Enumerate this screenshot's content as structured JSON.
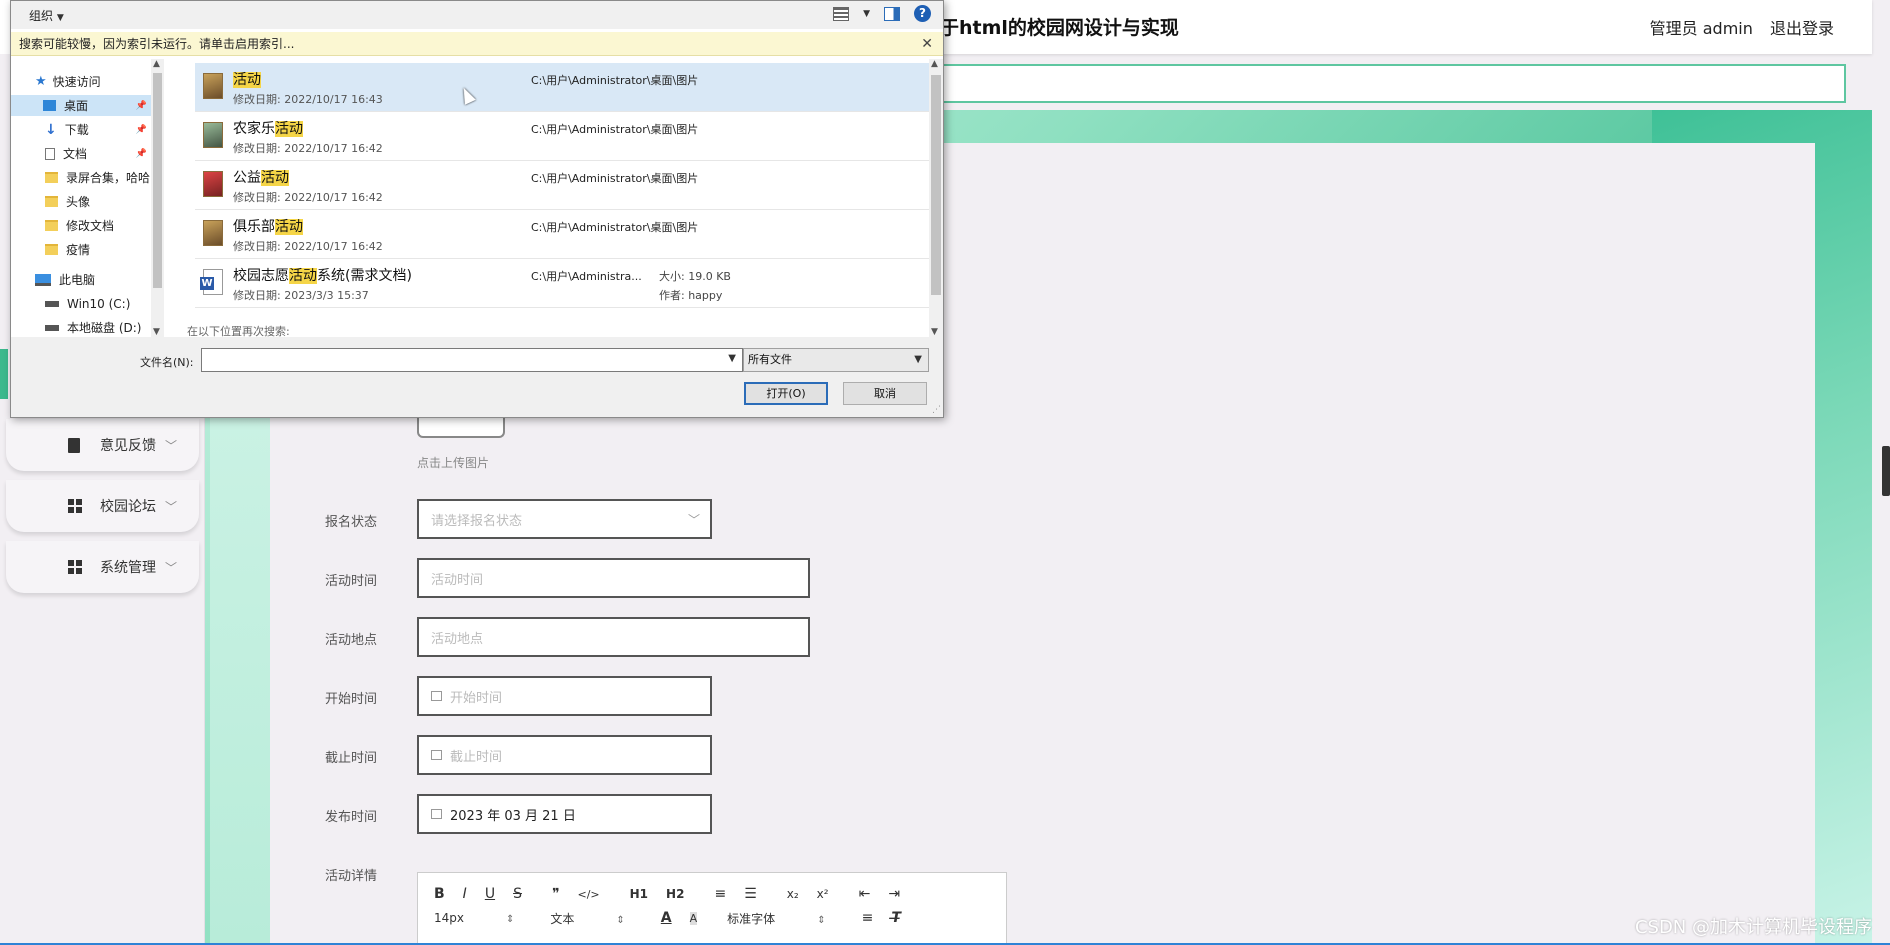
{
  "site": {
    "title": "于html的校园网设计与实现",
    "user": "管理员 admin",
    "logout": "退出登录"
  },
  "sidebar": {
    "items": [
      {
        "label": "意见反馈"
      },
      {
        "label": "校园论坛"
      },
      {
        "label": "系统管理"
      }
    ]
  },
  "form": {
    "upload_hint": "点击上传图片",
    "fields": [
      {
        "label": "报名状态",
        "placeholder": "请选择报名状态",
        "value": ""
      },
      {
        "label": "活动时间",
        "placeholder": "活动时间",
        "value": ""
      },
      {
        "label": "活动地点",
        "placeholder": "活动地点",
        "value": ""
      },
      {
        "label": "开始时间",
        "placeholder": "开始时间",
        "value": ""
      },
      {
        "label": "截止时间",
        "placeholder": "截止时间",
        "value": ""
      },
      {
        "label": "发布时间",
        "placeholder": "",
        "value": "2023 年 03 月 21 日"
      },
      {
        "label": "活动详情"
      }
    ],
    "editor": {
      "row1": [
        "B",
        "I",
        "U",
        "S",
        "❞",
        "</>",
        "H1",
        "H2",
        "≡",
        "☰",
        "x₂",
        "x²",
        "⇤",
        "⇥"
      ],
      "font_size": "14px",
      "text_type": "文本",
      "font_family": "标准字体"
    }
  },
  "watermark": "CSDN @加木计算机毕设程序",
  "dialog": {
    "organize": "组织",
    "infobar": "搜索可能较慢，因为索引未运行。请单击启用索引...",
    "nav": [
      {
        "label": "快速访问",
        "icon": "star-icon"
      },
      {
        "label": "桌面",
        "icon": "desktop-icon",
        "selected": true,
        "pinned": true
      },
      {
        "label": "下载",
        "icon": "download-icon",
        "pinned": true
      },
      {
        "label": "文档",
        "icon": "document-icon",
        "pinned": true
      },
      {
        "label": "录屏合集，哈哈",
        "icon": "folder-icon"
      },
      {
        "label": "头像",
        "icon": "folder-icon"
      },
      {
        "label": "修改文档",
        "icon": "folder-icon"
      },
      {
        "label": "疫情",
        "icon": "folder-icon"
      },
      {
        "label": "此电脑",
        "icon": "computer-icon"
      },
      {
        "label": "Win10 (C:)",
        "icon": "drive-icon"
      },
      {
        "label": "本地磁盘 (D:)",
        "icon": "drive-icon"
      }
    ],
    "files": [
      {
        "pre": "",
        "hl": "活动",
        "post": "",
        "date": "修改日期: 2022/10/17 16:43",
        "path": "C:\\用户\\Administrator\\桌面\\图片",
        "selected": true
      },
      {
        "pre": "农家乐",
        "hl": "活动",
        "post": "",
        "date": "修改日期: 2022/10/17 16:42",
        "path": "C:\\用户\\Administrator\\桌面\\图片"
      },
      {
        "pre": "公益",
        "hl": "活动",
        "post": "",
        "date": "修改日期: 2022/10/17 16:42",
        "path": "C:\\用户\\Administrator\\桌面\\图片"
      },
      {
        "pre": "俱乐部",
        "hl": "活动",
        "post": "",
        "date": "修改日期: 2022/10/17 16:42",
        "path": "C:\\用户\\Administrator\\桌面\\图片"
      },
      {
        "pre": "校园志愿",
        "hl": "活动",
        "post": "系统(需求文档)",
        "date": "修改日期: 2023/3/3 15:37",
        "path": "C:\\用户\\Administra...",
        "size": "大小: 19.0 KB",
        "author": "作者: happy"
      }
    ],
    "research": "在以下位置再次搜索:",
    "filename_label": "文件名(N):",
    "filename_value": "",
    "filetype": "所有文件",
    "open": "打开(O)",
    "cancel": "取消"
  }
}
